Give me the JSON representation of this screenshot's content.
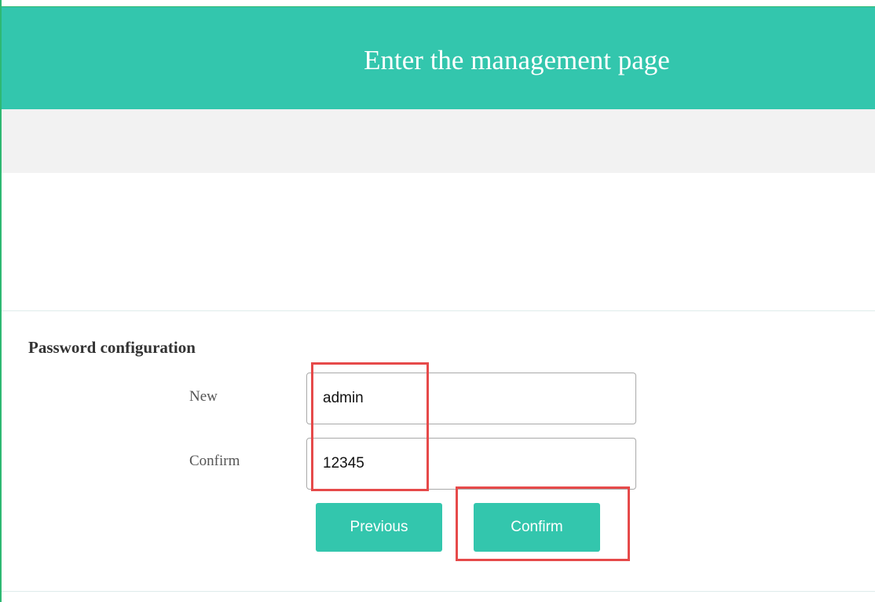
{
  "header": {
    "title": "Enter the management page"
  },
  "password_section": {
    "title": "Password configuration",
    "new_label": "New",
    "new_value": "admin",
    "confirm_label": "Confirm",
    "confirm_value": "12345"
  },
  "buttons": {
    "previous_label": "Previous",
    "confirm_label": "Confirm"
  },
  "colors": {
    "accent": "#33c6ad",
    "annotation": "#e64a4a",
    "band": "#f2f2f2"
  }
}
